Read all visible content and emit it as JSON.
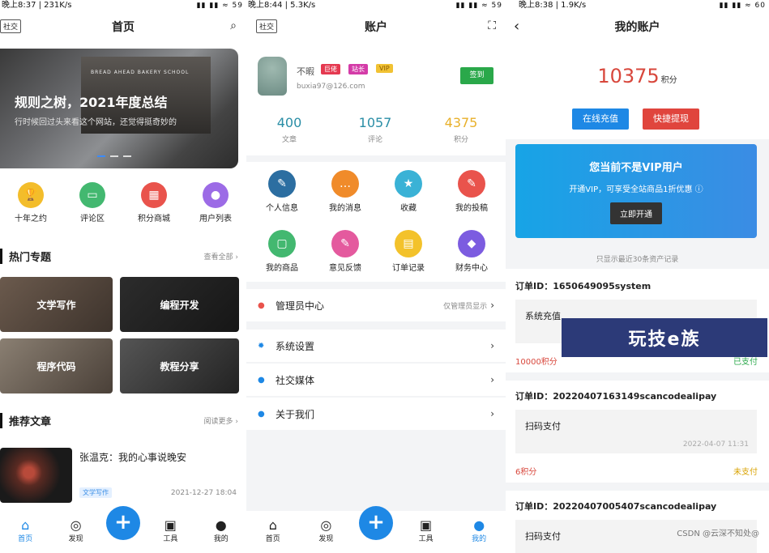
{
  "p1": {
    "status": {
      "left": "晚上8:37 | 231K/s",
      "right": "▮▮ ▮▮ ≈ 59"
    },
    "tag": "社交",
    "title": "首页",
    "banner": {
      "title": "规则之树，2021年度总结",
      "subtitle": "行时候回过头来看这个网站，还觉得挺奇妙的",
      "shop_text": "BREAD AHEAD  BAKERY SCHOOL"
    },
    "icons": [
      {
        "label": "十年之约",
        "color": "#f3bd2b",
        "icon": "trophy-icon",
        "glyph": "🏆"
      },
      {
        "label": "评论区",
        "color": "#43b870",
        "icon": "comment-icon",
        "glyph": "▭"
      },
      {
        "label": "积分商城",
        "color": "#e9534c",
        "icon": "store-icon",
        "glyph": "▦"
      },
      {
        "label": "用户列表",
        "color": "#9c6be6",
        "icon": "user-icon",
        "glyph": "●"
      }
    ],
    "hot": {
      "title": "热门专题",
      "more": "查看全部 ›"
    },
    "topics": [
      "文学写作",
      "编程开发",
      "程序代码",
      "教程分享"
    ],
    "recommend": {
      "title": "推荐文章",
      "more": "阅读更多 ›"
    },
    "article": {
      "title": "张温克：我的心事说晚安",
      "tag": "文学写作",
      "date": "2021-12-27 18:04"
    },
    "tabs": [
      "首页",
      "发现",
      "+",
      "工具",
      "我的"
    ]
  },
  "p2": {
    "status": {
      "left": "晚上8:44 | 5.3K/s",
      "right": "▮▮ ▮▮ ≈ 59"
    },
    "tag": "社交",
    "title": "账户",
    "user": {
      "name": "不暇",
      "email": "buxia97@126.com",
      "badges": [
        {
          "text": "巨佬",
          "color": "#e53950"
        },
        {
          "text": "站长",
          "color": "#d43ca8"
        },
        {
          "text": "VIP",
          "color": "#f1c233"
        }
      ]
    },
    "signin": "签到",
    "stats": [
      {
        "value": "400",
        "label": "文章",
        "color": "#2a8ea6"
      },
      {
        "value": "1057",
        "label": "评论",
        "color": "#2a8ea6"
      },
      {
        "value": "4375",
        "label": "积分",
        "color": "#e8b02a"
      }
    ],
    "grid": [
      {
        "label": "个人信息",
        "color": "#2c6ea1",
        "icon": "profile-icon",
        "glyph": "✎"
      },
      {
        "label": "我的消息",
        "color": "#f08b2a",
        "icon": "message-icon",
        "glyph": "…"
      },
      {
        "label": "收藏",
        "color": "#3ab2d6",
        "icon": "star-icon",
        "glyph": "★"
      },
      {
        "label": "我的投稿",
        "color": "#e9534c",
        "icon": "pen-icon",
        "glyph": "✎"
      },
      {
        "label": "我的商品",
        "color": "#43b870",
        "icon": "goods-icon",
        "glyph": "▢"
      },
      {
        "label": "意见反馈",
        "color": "#e45a9e",
        "icon": "feedback-icon",
        "glyph": "✎"
      },
      {
        "label": "订单记录",
        "color": "#f3c22b",
        "icon": "order-icon",
        "glyph": "▤"
      },
      {
        "label": "财务中心",
        "color": "#7c5ce0",
        "icon": "diamond-icon",
        "glyph": "◆"
      }
    ],
    "menu": [
      {
        "label": "管理员中心",
        "right": "仅管理员显示",
        "color": "#e9534c",
        "icon": "palette-icon"
      },
      {
        "label": "系统设置",
        "right": "",
        "color": "#1e88e5",
        "icon": "settings-icon"
      },
      {
        "label": "社交媒体",
        "right": "",
        "color": "#1e88e5",
        "icon": "social-icon"
      },
      {
        "label": "关于我们",
        "right": "",
        "color": "#1e88e5",
        "icon": "about-icon"
      }
    ],
    "tabs": [
      "首页",
      "发现",
      "+",
      "工具",
      "我的"
    ]
  },
  "p3": {
    "status": {
      "left": "晚上8:38 | 1.9K/s",
      "right": "▮▮ ▮▮ ≈ 60"
    },
    "title": "我的账户",
    "balance": {
      "value": "10375",
      "unit": "积分"
    },
    "recharge": "在线充值",
    "withdraw": "快捷提现",
    "vip": {
      "title": "您当前不是VIP用户",
      "subtitle": "开通VIP，可享受全站商品1折优惠 ⓘ",
      "button": "立即开通"
    },
    "note": "只显示最近30条资产记录",
    "orders": [
      {
        "id": "订单ID：1650649095system",
        "type": "系统充值",
        "date": "",
        "points": "10000积分",
        "status": "已支付",
        "paid": true
      },
      {
        "id": "订单ID：20220407163149scancodealipay",
        "type": "扫码支付",
        "date": "2022-04-07 11:31",
        "points": "6积分",
        "status": "未支付",
        "paid": false
      },
      {
        "id": "订单ID：20220407005407scancodealipay",
        "type": "扫码支付",
        "date": "",
        "points": "",
        "status": "",
        "paid": false
      }
    ],
    "overlay": "玩技e族",
    "watermark": "CSDN @云深不知处@"
  }
}
